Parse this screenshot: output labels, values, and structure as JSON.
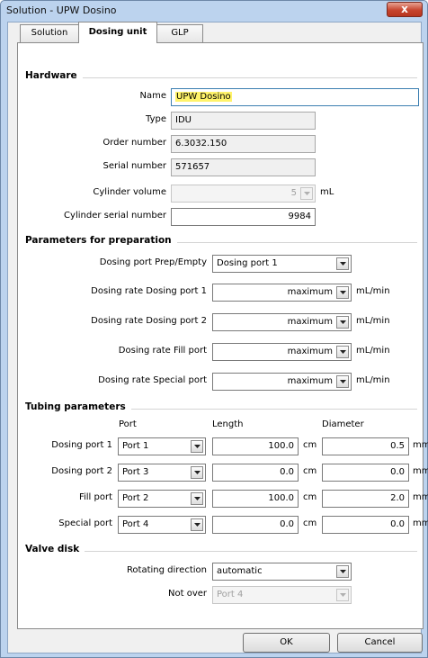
{
  "window": {
    "title": "Solution - UPW Dosino",
    "close_label": "x"
  },
  "tabs": [
    {
      "label": "Solution",
      "active": false
    },
    {
      "label": "Dosing unit",
      "active": true
    },
    {
      "label": "GLP",
      "active": false
    }
  ],
  "hardware": {
    "heading": "Hardware",
    "name_label": "Name",
    "name_value": "UPW Dosino",
    "type_label": "Type",
    "type_value": "IDU",
    "order_label": "Order number",
    "order_value": "6.3032.150",
    "serial_label": "Serial number",
    "serial_value": "571657",
    "cyl_volume_label": "Cylinder volume",
    "cyl_volume_value": "5",
    "cyl_volume_unit": "mL",
    "cyl_serial_label": "Cylinder serial number",
    "cyl_serial_value": "9984"
  },
  "preparation": {
    "heading": "Parameters for preparation",
    "port_label": "Dosing port Prep/Empty",
    "port_value": "Dosing port 1",
    "rates": [
      {
        "label": "Dosing rate Dosing port 1",
        "value": "maximum",
        "unit": "mL/min"
      },
      {
        "label": "Dosing rate Dosing port 2",
        "value": "maximum",
        "unit": "mL/min"
      },
      {
        "label": "Dosing rate Fill port",
        "value": "maximum",
        "unit": "mL/min"
      },
      {
        "label": "Dosing rate Special port",
        "value": "maximum",
        "unit": "mL/min"
      }
    ]
  },
  "tubing": {
    "heading": "Tubing parameters",
    "col_port": "Port",
    "col_length": "Length",
    "col_diameter": "Diameter",
    "rows": [
      {
        "label": "Dosing port 1",
        "port": "Port 1",
        "length": "100.0",
        "length_unit": "cm",
        "diameter": "0.5",
        "diameter_unit": "mm"
      },
      {
        "label": "Dosing port 2",
        "port": "Port 3",
        "length": "0.0",
        "length_unit": "cm",
        "diameter": "0.0",
        "diameter_unit": "mm"
      },
      {
        "label": "Fill port",
        "port": "Port 2",
        "length": "100.0",
        "length_unit": "cm",
        "diameter": "2.0",
        "diameter_unit": "mm"
      },
      {
        "label": "Special port",
        "port": "Port 4",
        "length": "0.0",
        "length_unit": "cm",
        "diameter": "0.0",
        "diameter_unit": "mm"
      }
    ]
  },
  "valve": {
    "heading": "Valve disk",
    "direction_label": "Rotating direction",
    "direction_value": "automatic",
    "notover_label": "Not over",
    "notover_value": "Port 4"
  },
  "buttons": {
    "ok": "OK",
    "cancel": "Cancel"
  }
}
